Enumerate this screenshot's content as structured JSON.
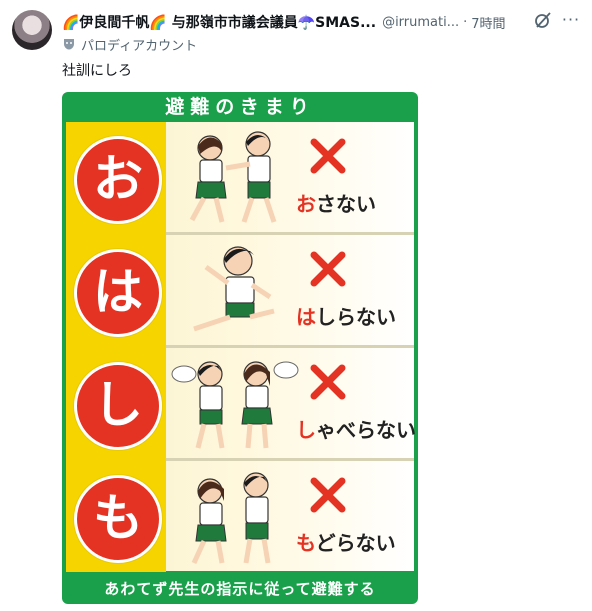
{
  "tweet": {
    "display_name": "🌈伊良間千帆🌈 与那嶺市市議会議員☂️SMAS...",
    "handle": "@irrumati...",
    "separator": "·",
    "time": "7時間",
    "parody_label": "パロディアカウント",
    "text": "社訓にしろ",
    "more_label": "···"
  },
  "poster": {
    "title": "避難のきまり",
    "rules": [
      {
        "letter": "お",
        "highlight": "お",
        "rest": "さない"
      },
      {
        "letter": "は",
        "highlight": "は",
        "rest": "しらない"
      },
      {
        "letter": "し",
        "highlight": "し",
        "rest": "ゃべらない"
      },
      {
        "letter": "も",
        "highlight": "も",
        "rest": "どらない"
      }
    ],
    "footer": "あわてず先生の指示に従って避難する",
    "colors": {
      "green": "#1aa04b",
      "red": "#e43323",
      "yellow": "#f5d400"
    }
  }
}
